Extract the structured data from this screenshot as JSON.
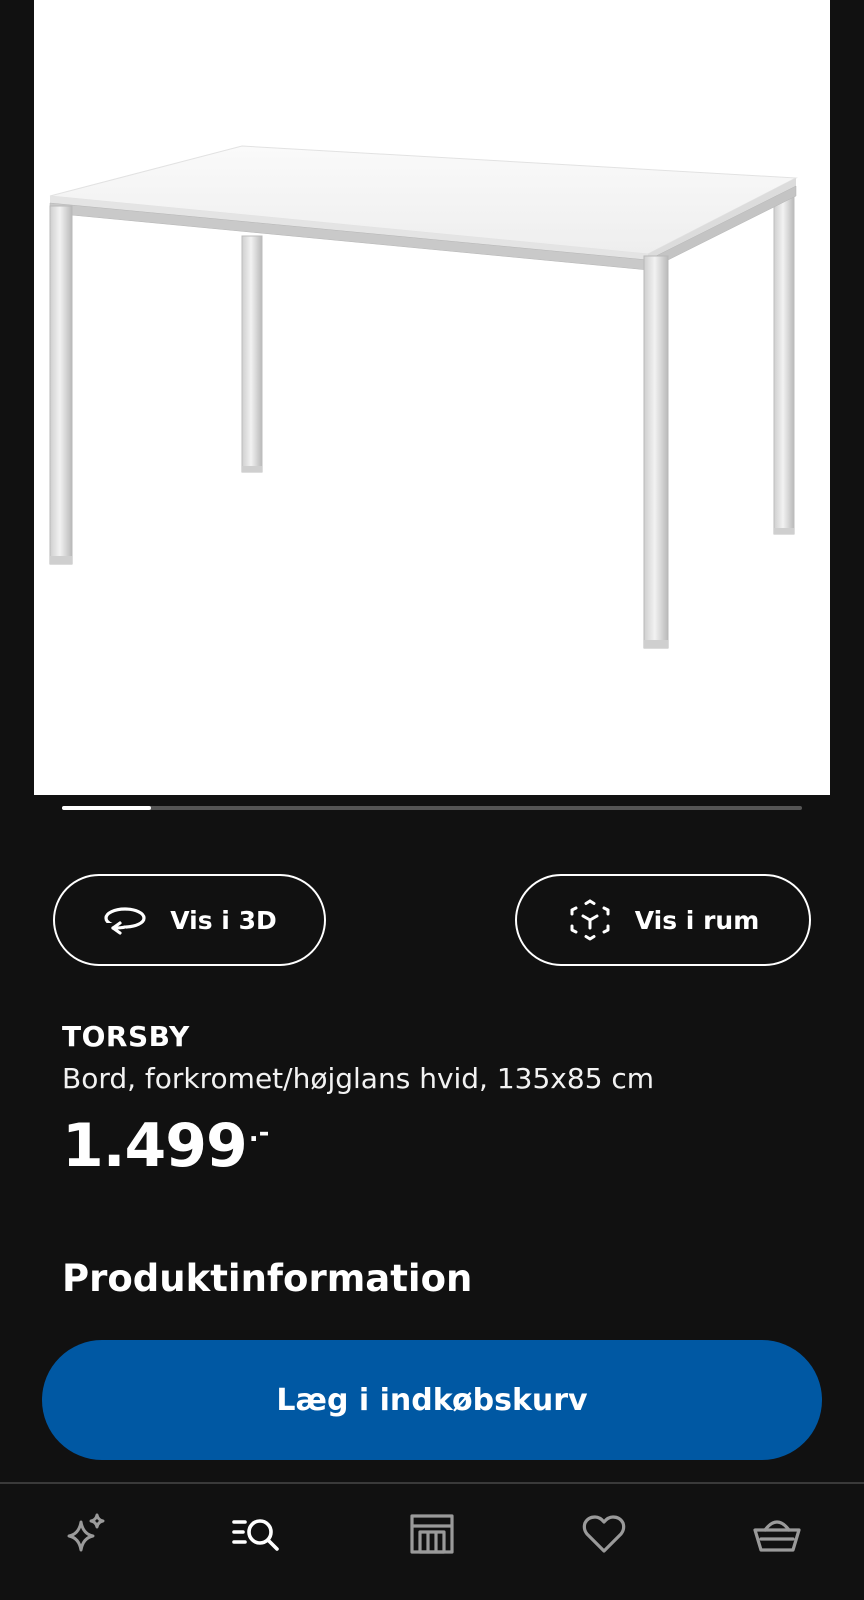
{
  "product_image": {
    "alt": "TORSBY"
  },
  "gallery": {
    "progress": 0.12
  },
  "actions": {
    "view_3d_label": "Vis i 3D",
    "view_room_label": "Vis i rum"
  },
  "product": {
    "name": "TORSBY",
    "description": "Bord, forkromet/højglans hvid, 135x85 cm",
    "price": "1.499",
    "price_suffix": ".-"
  },
  "sections": {
    "product_info_title": "Produktinformation"
  },
  "cart": {
    "add_label": "Læg i indkøbskurv"
  },
  "bottom_nav": {
    "items": [
      {
        "icon": "sparkle-icon"
      },
      {
        "icon": "search-list-icon"
      },
      {
        "icon": "store-icon"
      },
      {
        "icon": "heart-icon"
      },
      {
        "icon": "basket-icon"
      }
    ]
  },
  "colors": {
    "background": "#111111",
    "accent": "#0058a3",
    "text": "#ffffff",
    "icon_inactive": "#9a9a9a"
  }
}
